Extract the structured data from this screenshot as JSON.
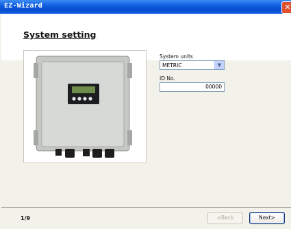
{
  "window": {
    "title": "EZ-Wizard",
    "close_glyph": "✕"
  },
  "page": {
    "title": "System setting",
    "step": "1/9"
  },
  "system_units": {
    "label": "System units",
    "value": "METRIC"
  },
  "id_no": {
    "label": "ID No.",
    "value": "00000"
  },
  "buttons": {
    "back": "<Back",
    "next": "Next>"
  },
  "icons": [
    "close-icon",
    "dropdown-arrow-icon"
  ]
}
